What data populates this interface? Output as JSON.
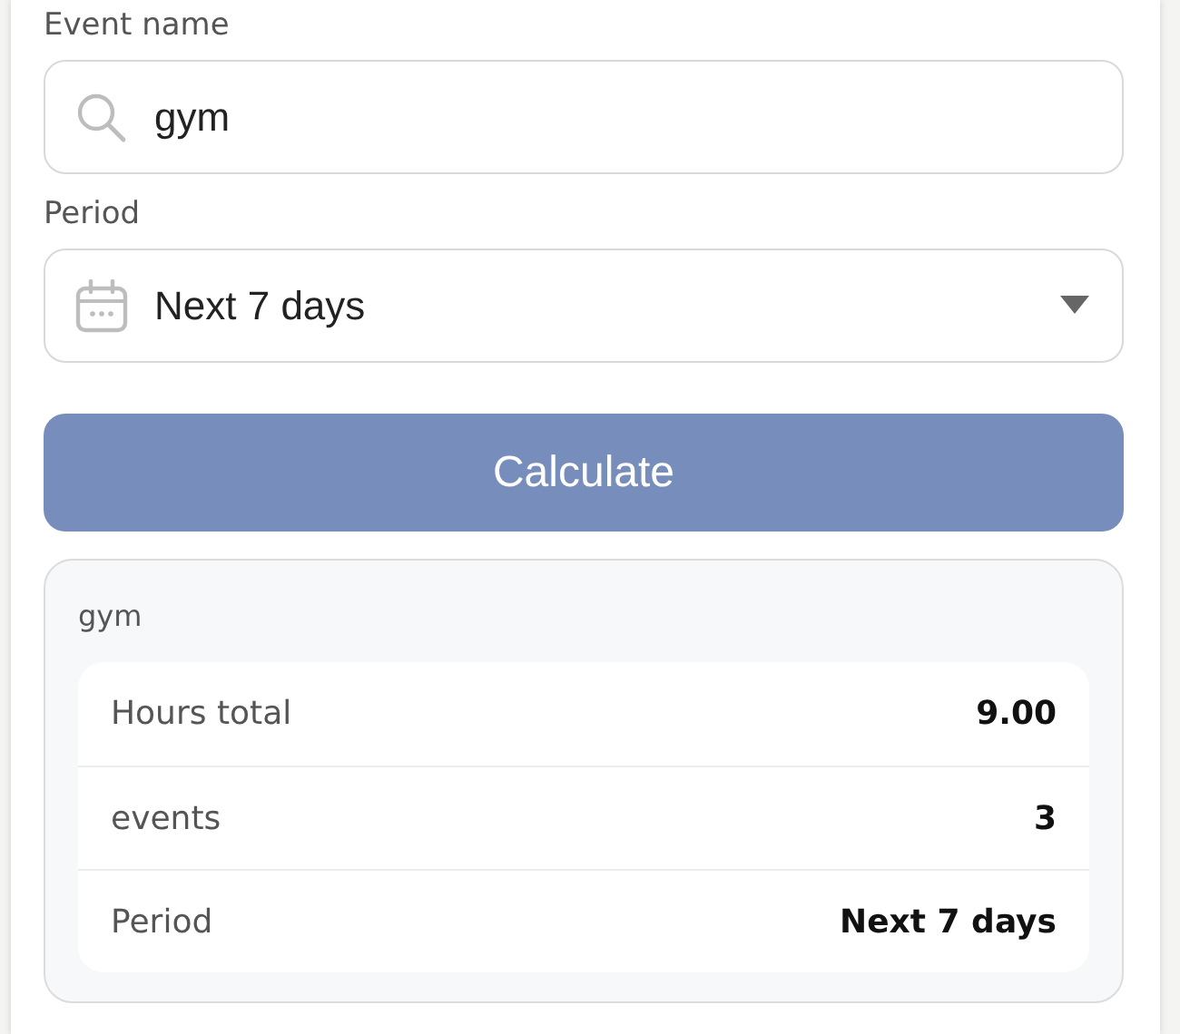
{
  "event_name": {
    "label": "Event name",
    "value": "gym"
  },
  "period": {
    "label": "Period",
    "value": "Next 7 days"
  },
  "calculate_button": {
    "label": "Calculate"
  },
  "result": {
    "title": "gym",
    "rows": [
      {
        "label": "Hours total",
        "value": "9.00"
      },
      {
        "label": "events",
        "value": "3"
      },
      {
        "label": "Period",
        "value": "Next 7 days"
      }
    ]
  }
}
